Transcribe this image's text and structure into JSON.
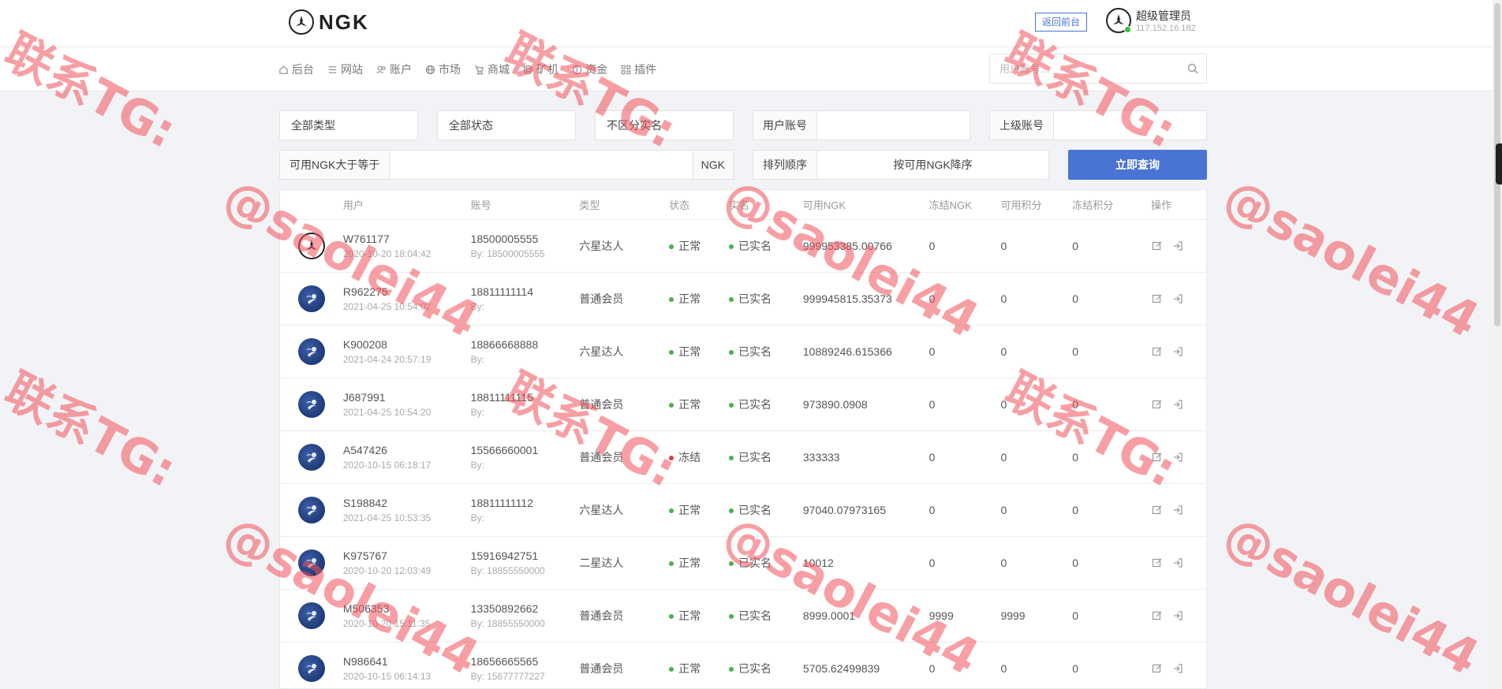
{
  "header": {
    "logo_text": "NGK",
    "frontend_link": "返回前台",
    "admin_name": "超级管理员",
    "admin_ip": "117.152.16.182"
  },
  "nav": {
    "items": [
      {
        "label": "后台",
        "icon": "home-icon"
      },
      {
        "label": "网站",
        "icon": "list-icon"
      },
      {
        "label": "账户",
        "icon": "users-icon"
      },
      {
        "label": "市场",
        "icon": "globe-icon"
      },
      {
        "label": "商城",
        "icon": "cart-icon"
      },
      {
        "label": "矿机",
        "icon": "miner-icon"
      },
      {
        "label": "资金",
        "icon": "coin-icon"
      },
      {
        "label": "插件",
        "icon": "grid-icon"
      }
    ],
    "search_placeholder": "用户账号..."
  },
  "filters": {
    "type": "全部类型",
    "status": "全部状态",
    "realname": "不区分实名",
    "user_account_label": "用户账号",
    "parent_account_label": "上级账号",
    "ngk_min_label": "可用NGK大于等于",
    "ngk_suffix": "NGK",
    "sort_label": "排列顺序",
    "sort_value": "按可用NGK降序",
    "query_button": "立即查询"
  },
  "table": {
    "headers": [
      "用户",
      "账号",
      "类型",
      "状态",
      "实名",
      "可用NGK",
      "冻结NGK",
      "可用积分",
      "冻结积分",
      "操作"
    ],
    "rows": [
      {
        "avatar": "logo",
        "user": "W761177",
        "time": "2020-10-20 18:04:42",
        "account": "18500005555",
        "by": "By: 18500005555",
        "type": "六星达人",
        "status": "正常",
        "status_color": "#4caf50",
        "realname": "已实名",
        "ngk": "999953385.00766",
        "fngk": "0",
        "pts": "0",
        "fpts": "0"
      },
      {
        "avatar": "moon",
        "user": "R962275",
        "time": "2021-04-25 10:54:02",
        "account": "18811111114",
        "by": "By:",
        "type": "普通会员",
        "status": "正常",
        "status_color": "#4caf50",
        "realname": "已实名",
        "ngk": "999945815.35373",
        "fngk": "0",
        "pts": "0",
        "fpts": "0"
      },
      {
        "avatar": "moon",
        "user": "K900208",
        "time": "2021-04-24 20:57:19",
        "account": "18866668888",
        "by": "By:",
        "type": "六星达人",
        "status": "正常",
        "status_color": "#4caf50",
        "realname": "已实名",
        "ngk": "10889246.615366",
        "fngk": "0",
        "pts": "0",
        "fpts": "0"
      },
      {
        "avatar": "moon",
        "user": "J687991",
        "time": "2021-04-25 10:54:20",
        "account": "18811111115",
        "by": "By:",
        "type": "普通会员",
        "status": "正常",
        "status_color": "#4caf50",
        "realname": "已实名",
        "ngk": "973890.0908",
        "fngk": "0",
        "pts": "0",
        "fpts": "0"
      },
      {
        "avatar": "moon",
        "user": "A547426",
        "time": "2020-10-15 06:18:17",
        "account": "15566660001",
        "by": "By:",
        "type": "普通会员",
        "status": "冻结",
        "status_color": "#e53935",
        "realname": "已实名",
        "ngk": "333333",
        "fngk": "0",
        "pts": "0",
        "fpts": "0"
      },
      {
        "avatar": "moon",
        "user": "S198842",
        "time": "2021-04-25 10:53:35",
        "account": "18811111112",
        "by": "By:",
        "type": "六星达人",
        "status": "正常",
        "status_color": "#4caf50",
        "realname": "已实名",
        "ngk": "97040.07973165",
        "fngk": "0",
        "pts": "0",
        "fpts": "0"
      },
      {
        "avatar": "moon",
        "user": "K975767",
        "time": "2020-10-20 12:03:49",
        "account": "15916942751",
        "by": "By: 18855550000",
        "type": "二星达人",
        "status": "正常",
        "status_color": "#4caf50",
        "realname": "已实名",
        "ngk": "10012",
        "fngk": "0",
        "pts": "0",
        "fpts": "0"
      },
      {
        "avatar": "moon",
        "user": "M506353",
        "time": "2020-10-20 15:11:35",
        "account": "13350892662",
        "by": "By: 18855550000",
        "type": "普通会员",
        "status": "正常",
        "status_color": "#4caf50",
        "realname": "已实名",
        "ngk": "8999.0001",
        "fngk": "9999",
        "pts": "9999",
        "fpts": "0"
      },
      {
        "avatar": "moon",
        "user": "N986641",
        "time": "2020-10-15 06:14:13",
        "account": "18656665565",
        "by": "By: 15677777227",
        "type": "普通会员",
        "status": "正常",
        "status_color": "#4caf50",
        "realname": "已实名",
        "ngk": "5705.62499839",
        "fngk": "0",
        "pts": "0",
        "fpts": "0"
      }
    ]
  },
  "watermarks": {
    "line1": "联系TG:",
    "line2": "@saolei44"
  }
}
